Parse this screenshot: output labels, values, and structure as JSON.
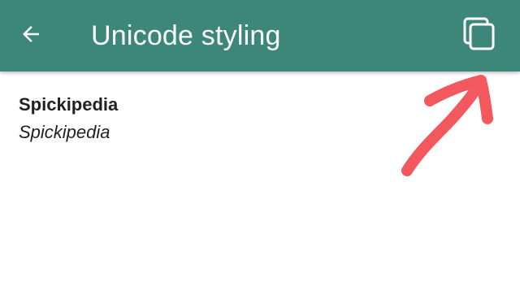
{
  "app_bar": {
    "title": "Unicode styling",
    "back_icon": "arrow-left-icon",
    "copy_icon": "copy-icon",
    "background_color": "#3c877a"
  },
  "content": {
    "bold_text": "Spickipedia",
    "italic_text": "Spickipedia"
  },
  "annotation": {
    "type": "hand-drawn arrow pointing to copy button",
    "color": "#f2585d"
  }
}
